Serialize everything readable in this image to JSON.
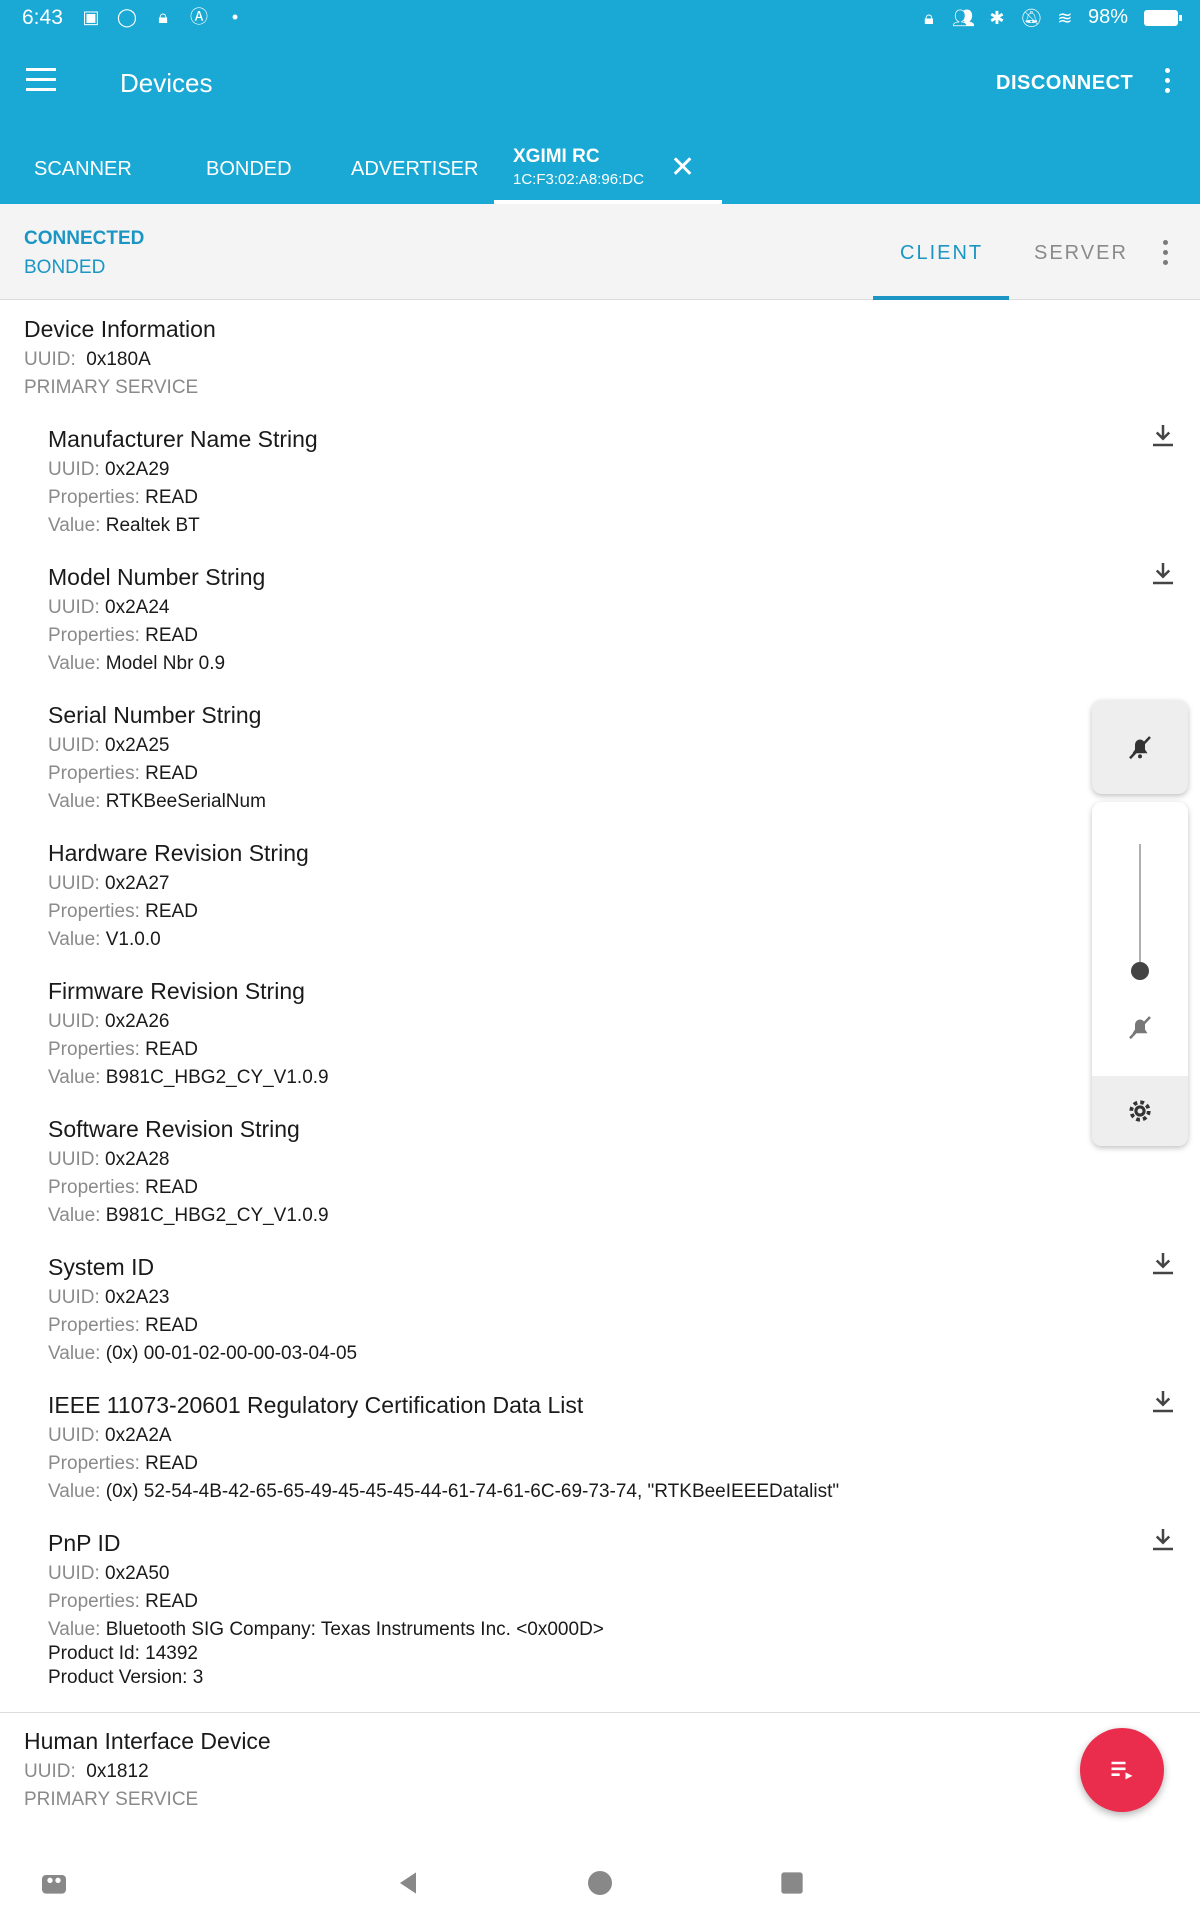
{
  "status_bar": {
    "time": "6:43",
    "battery": "98%",
    "left_icons": [
      "image-icon",
      "circle-icon",
      "lock-icon",
      "a-icon",
      "dot-icon"
    ],
    "right_icons": [
      "vpn-lock-icon",
      "people-icon",
      "bluetooth-icon",
      "bell-off-icon",
      "wifi-icon"
    ]
  },
  "appbar": {
    "title": "Devices",
    "disconnect_label": "DISCONNECT"
  },
  "tabs": [
    {
      "label": "SCANNER"
    },
    {
      "label": "BONDED"
    },
    {
      "label": "ADVERTISER"
    }
  ],
  "device_tab": {
    "name": "XGIMI RC",
    "address": "1C:F3:02:A8:96:DC"
  },
  "connection": {
    "status": "CONNECTED",
    "bond": "BONDED",
    "client_label": "CLIENT",
    "server_label": "SERVER"
  },
  "labels": {
    "uuid": "UUID:",
    "properties": "Properties:",
    "value": "Value:"
  },
  "services": [
    {
      "name": "Device Information",
      "uuid": "0x180A",
      "type": "PRIMARY SERVICE",
      "characteristics": [
        {
          "name": "Manufacturer Name String",
          "uuid": "0x2A29",
          "properties": "READ",
          "value": "Realtek BT"
        },
        {
          "name": "Model Number String",
          "uuid": "0x2A24",
          "properties": "READ",
          "value": "Model Nbr 0.9"
        },
        {
          "name": "Serial Number String",
          "uuid": "0x2A25",
          "properties": "READ",
          "value": "RTKBeeSerialNum"
        },
        {
          "name": "Hardware Revision String",
          "uuid": "0x2A27",
          "properties": "READ",
          "value": "V1.0.0"
        },
        {
          "name": "Firmware Revision String",
          "uuid": "0x2A26",
          "properties": "READ",
          "value": "B981C_HBG2_CY_V1.0.9"
        },
        {
          "name": "Software Revision String",
          "uuid": "0x2A28",
          "properties": "READ",
          "value": "B981C_HBG2_CY_V1.0.9"
        },
        {
          "name": "System ID",
          "uuid": "0x2A23",
          "properties": "READ",
          "value": "(0x) 00-01-02-00-00-03-04-05"
        },
        {
          "name": "IEEE 11073-20601 Regulatory Certification Data List",
          "uuid": "0x2A2A",
          "properties": "READ",
          "value": "(0x) 52-54-4B-42-65-65-49-45-45-45-44-61-74-61-6C-69-73-74, \"RTKBeeIEEEDatalist\""
        },
        {
          "name": "PnP ID",
          "uuid": "0x2A50",
          "properties": "READ",
          "value": "Bluetooth SIG Company: Texas Instruments Inc. <0x000D>",
          "extra": [
            "Product Id: 14392",
            "Product Version: 3"
          ]
        }
      ]
    },
    {
      "name": "Human Interface Device",
      "uuid": "0x1812",
      "type": "PRIMARY SERVICE"
    }
  ],
  "colors": {
    "primary": "#1aa9d4",
    "accent": "#1b96c4",
    "fab": "#ea2d4c"
  }
}
